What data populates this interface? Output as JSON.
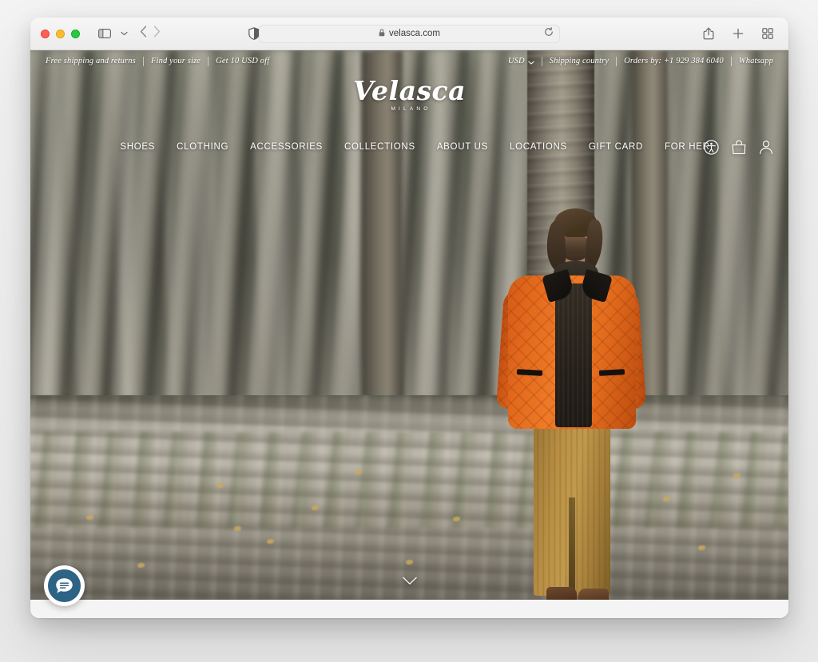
{
  "browser": {
    "name": "safari",
    "url": "velasca.com",
    "lock_icon": "lock-icon",
    "reload_icon": "reload-icon",
    "traffic_lights": [
      "close",
      "minimize",
      "maximize"
    ],
    "sidebar_icon": "sidebar-toggle-icon",
    "sidebar_chevron_icon": "chevron-down-icon",
    "back_icon": "back-arrow-icon",
    "forward_icon": "forward-arrow-icon",
    "shield_icon": "privacy-shield-icon",
    "share_icon": "share-icon",
    "new_tab_icon": "plus-icon",
    "tab_overview_icon": "tab-overview-icon"
  },
  "announcement": {
    "left_items": [
      "Free shipping and returns",
      "Find your size",
      "Get 10 USD off"
    ],
    "currency": "USD",
    "currency_chevron_icon": "chevron-down-icon",
    "right_items": [
      "Shipping country",
      "Orders by: +1 929 384 6040",
      "Whatsapp"
    ]
  },
  "logo": {
    "wordmark": "Velasca",
    "subtitle": "MILANO"
  },
  "nav": {
    "links": [
      "SHOES",
      "CLOTHING",
      "ACCESSORIES",
      "COLLECTIONS",
      "ABOUT US",
      "LOCATIONS",
      "GIFT CARD",
      "FOR HER"
    ],
    "icons": [
      "accessibility-icon",
      "shopping-bag-icon",
      "account-icon"
    ]
  },
  "hero": {
    "alt": "Man leaning against a tree in a poplar forest wearing an orange quilted jacket",
    "scroll_cue_icon": "chevron-down-icon"
  },
  "chat": {
    "icon": "chat-bubble-icon",
    "bubble_color": "#2d6384"
  },
  "colors": {
    "jacket_orange": "#e2691d",
    "trousers_tan": "#b98f44",
    "chat_blue": "#2d6384",
    "nav_text": "#ffffff"
  }
}
